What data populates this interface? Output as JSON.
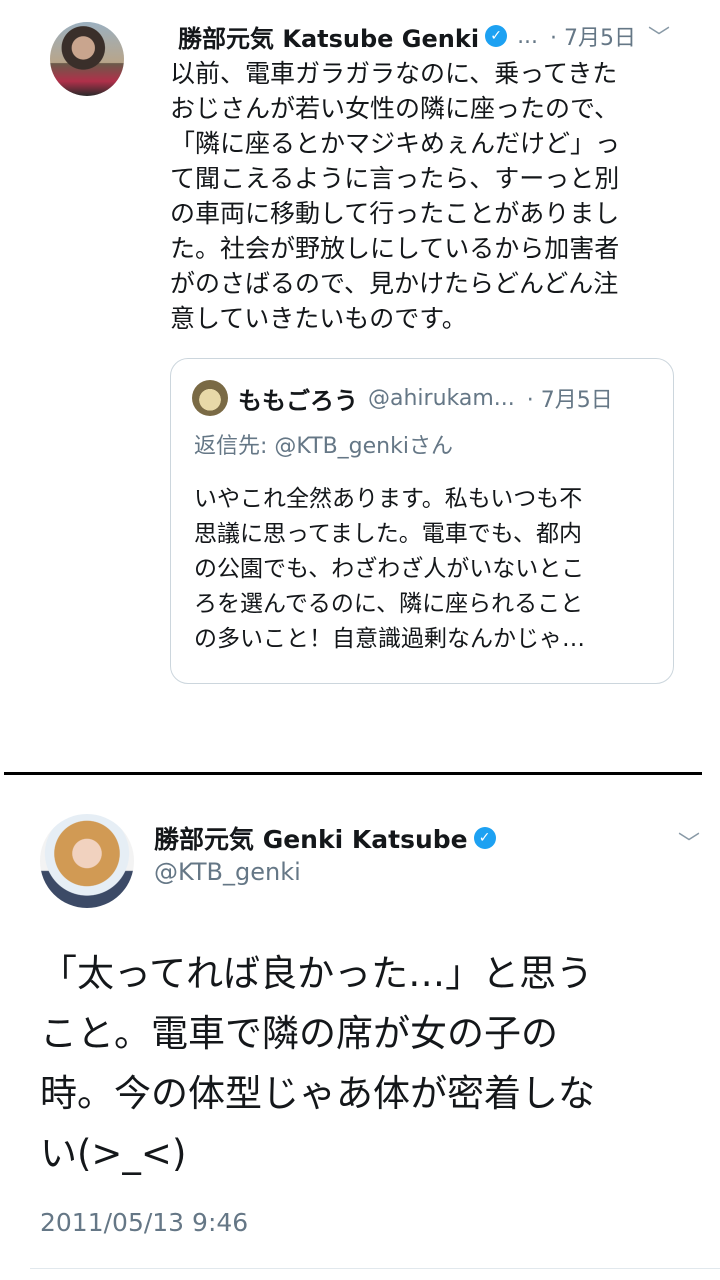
{
  "tweet1": {
    "author_name": "勝部元気 Katsube Genki",
    "header_ellipsis": "...",
    "date": "· 7月5日",
    "body_lines": [
      "以前、電車ガラガラなのに、乗ってきた",
      "おじさんが若い女性の隣に座ったので、",
      "「隣に座るとかマジキめぇんだけど」っ",
      "て聞こえるように言ったら、すーっと別",
      "の車両に移動して行ったことがありまし",
      "た。社会が野放しにしているから加害者",
      "がのさばるので、見かけたらどんどん注",
      "意していきたいものです。"
    ],
    "quote": {
      "name": "ももごろう",
      "handle": "@ahirukam...",
      "date": "· 7月5日",
      "reply_to": "返信先: @KTB_genkiさん",
      "body_lines": [
        "いやこれ全然あります。私もいつも不",
        "思議に思ってました。電車でも、都内",
        "の公園でも、わざわざ人がいないとこ",
        "ろを選んでるのに、隣に座られること",
        "の多いこと！自意識過剰なんかじゃ…"
      ]
    }
  },
  "tweet2": {
    "author_name": "勝部元気 Genki Katsube",
    "handle": "@KTB_genki",
    "body_lines": [
      "「太ってれば良かった…」と思う",
      "こと。電車で隣の席が女の子の",
      "時。今の体型じゃあ体が密着しな",
      "い(>_<)"
    ],
    "timestamp": "2011/05/13 9:46"
  },
  "icons": {
    "verified": "verified-check-icon",
    "chevron": "chevron-down-icon"
  },
  "colors": {
    "verified_blue": "#1da1f2",
    "secondary_text": "#657786",
    "border": "#ccd6dd"
  }
}
